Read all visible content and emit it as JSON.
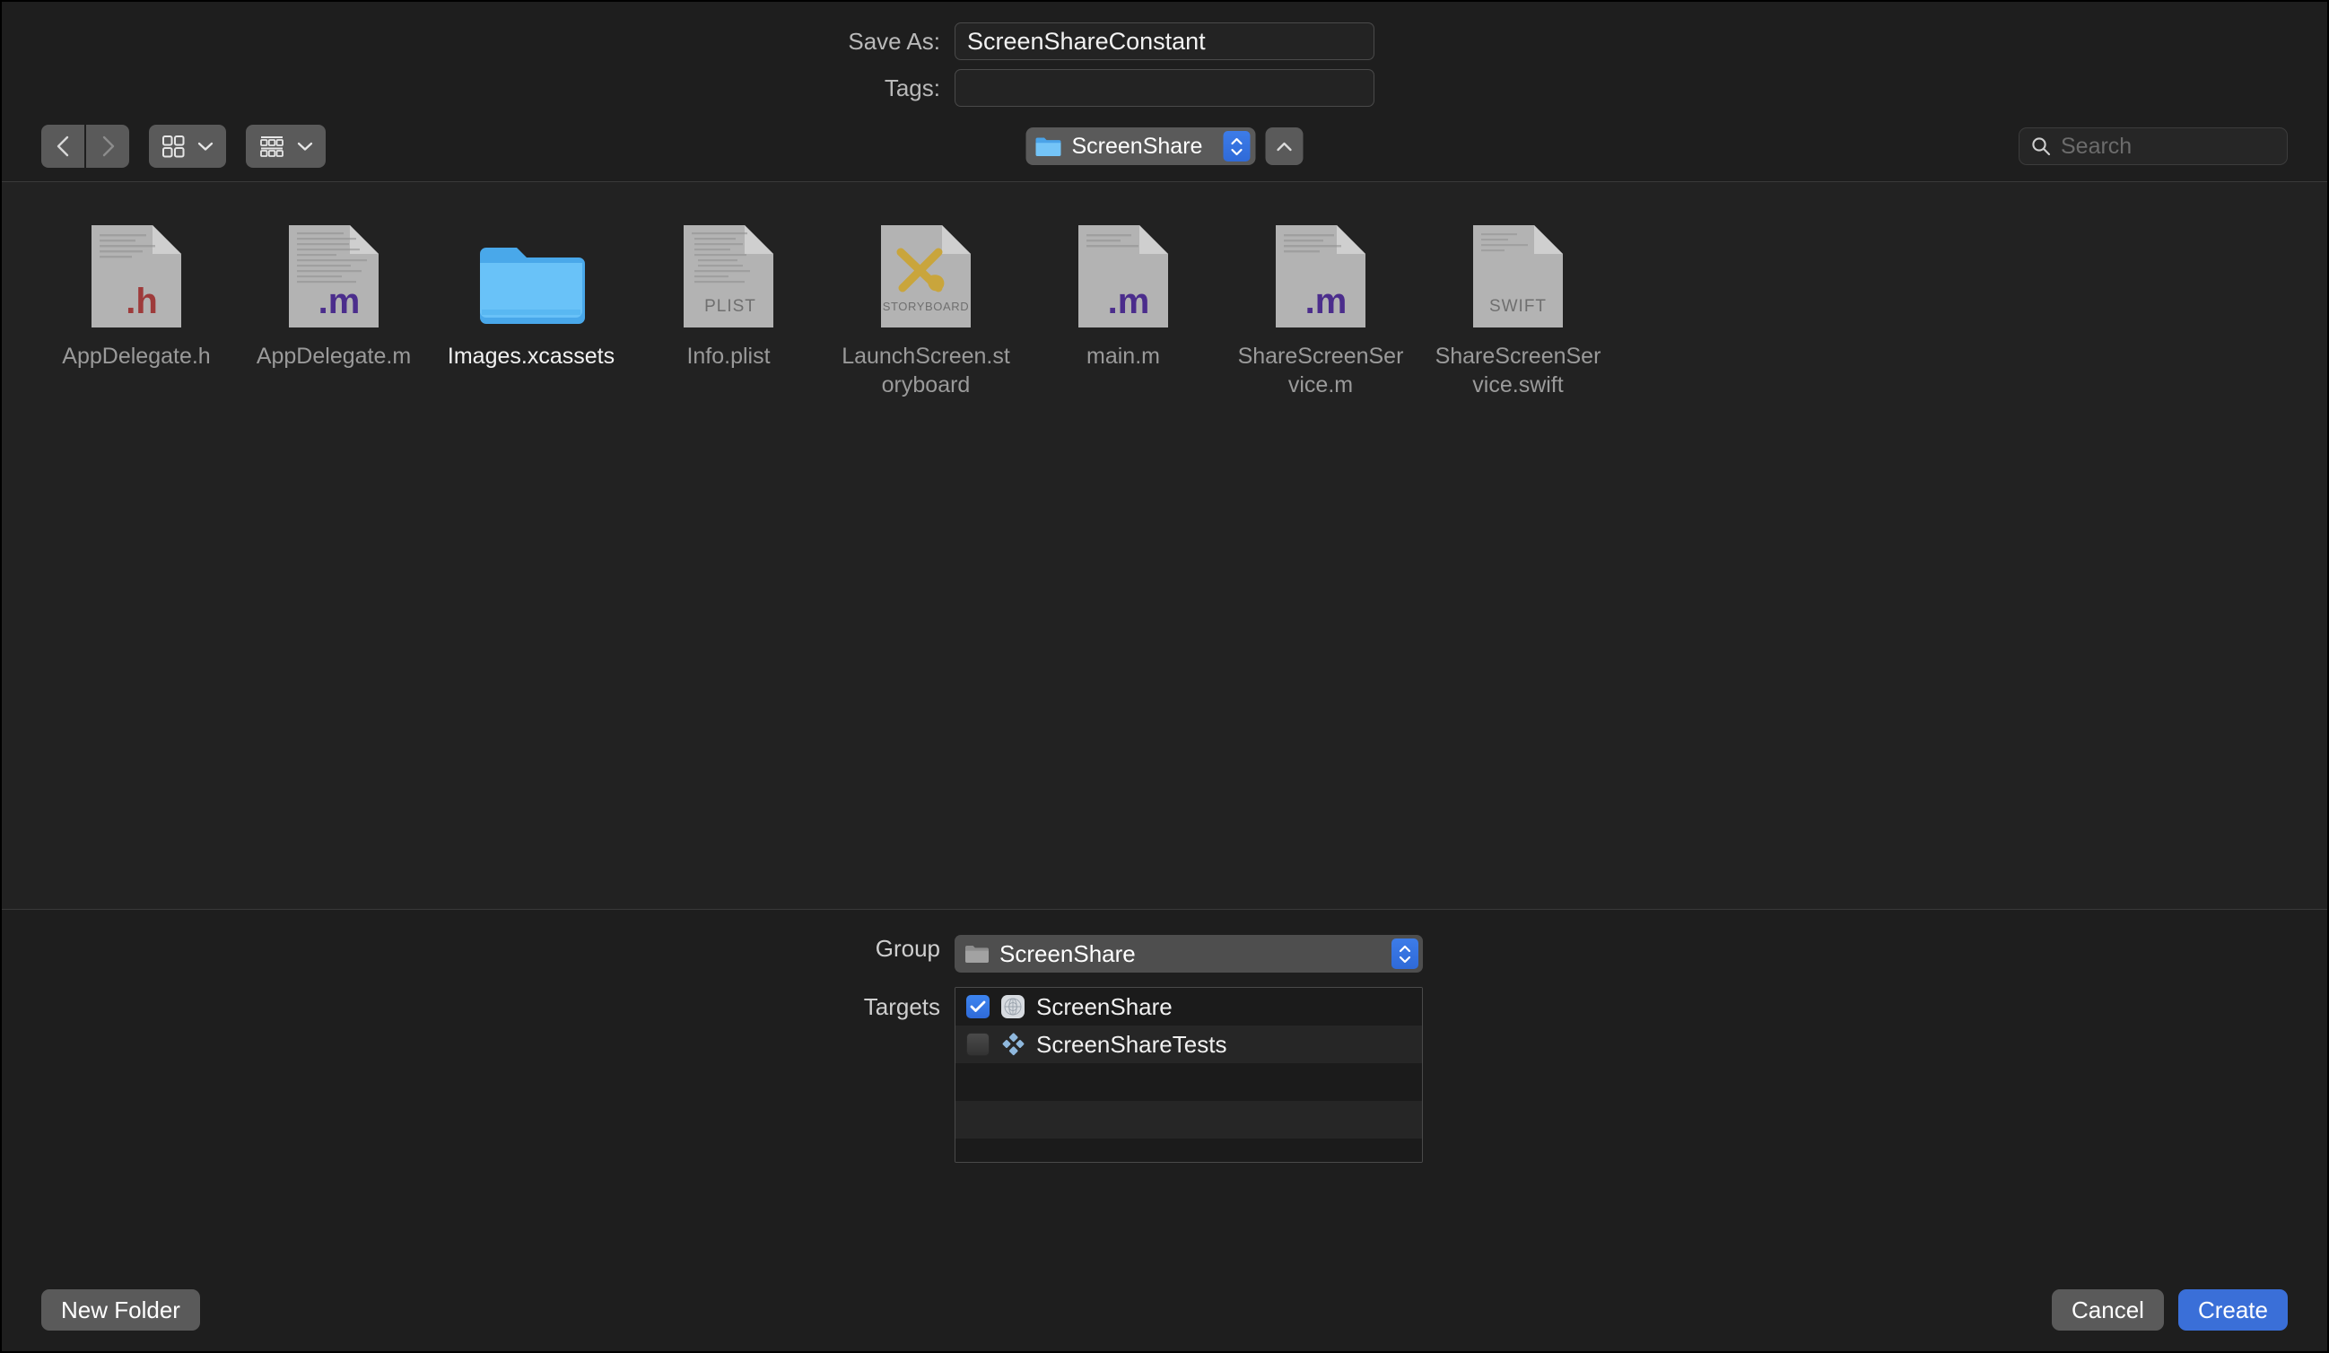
{
  "save_as": {
    "label": "Save As:",
    "value": "ScreenShareConstant"
  },
  "tags": {
    "label": "Tags:",
    "value": "",
    "placeholder": ""
  },
  "toolbar": {
    "back_icon": "chevron-left-icon",
    "forward_icon": "chevron-right-icon",
    "icon_view_icon": "grid-view-icon",
    "group_view_icon": "group-view-icon",
    "path_name": "ScreenShare",
    "up_icon": "chevron-up-icon",
    "search_placeholder": "Search",
    "search_value": ""
  },
  "files": [
    {
      "name": "AppDelegate.h",
      "kind": "source-h",
      "badge": ".h",
      "selectable": false
    },
    {
      "name": "AppDelegate.m",
      "kind": "source-m",
      "badge": ".m",
      "selectable": false
    },
    {
      "name": "Images.xcassets",
      "kind": "folder",
      "badge": "",
      "selectable": true
    },
    {
      "name": "Info.plist",
      "kind": "plist",
      "badge": "PLIST",
      "selectable": false
    },
    {
      "name": "LaunchScreen.storyboard",
      "kind": "storyboard",
      "badge": "STORYBOARD",
      "selectable": false
    },
    {
      "name": "main.m",
      "kind": "source-m",
      "badge": ".m",
      "selectable": false
    },
    {
      "name": "ShareScreenService.m",
      "kind": "source-m",
      "badge": ".m",
      "selectable": false
    },
    {
      "name": "ShareScreenService.swift",
      "kind": "swift",
      "badge": "SWIFT",
      "selectable": false
    }
  ],
  "group": {
    "label": "Group",
    "value": "ScreenShare",
    "folder_icon": "folder-icon"
  },
  "targets": {
    "label": "Targets",
    "items": [
      {
        "name": "ScreenShare",
        "checked": true,
        "icon": "app-target-icon"
      },
      {
        "name": "ScreenShareTests",
        "checked": false,
        "icon": "test-target-icon"
      },
      {
        "name": "",
        "checked": false,
        "icon": ""
      },
      {
        "name": "",
        "checked": false,
        "icon": ""
      },
      {
        "name": "",
        "checked": false,
        "icon": ""
      }
    ]
  },
  "footer": {
    "new_folder": "New Folder",
    "cancel": "Cancel",
    "create": "Create"
  },
  "colors": {
    "accent_blue": "#3a6fd8",
    "folder_blue": "#5ab4f5",
    "h_badge": "#9e3b3b",
    "m_badge": "#4b2d8c",
    "storyboard_gold": "#c9a53c"
  }
}
